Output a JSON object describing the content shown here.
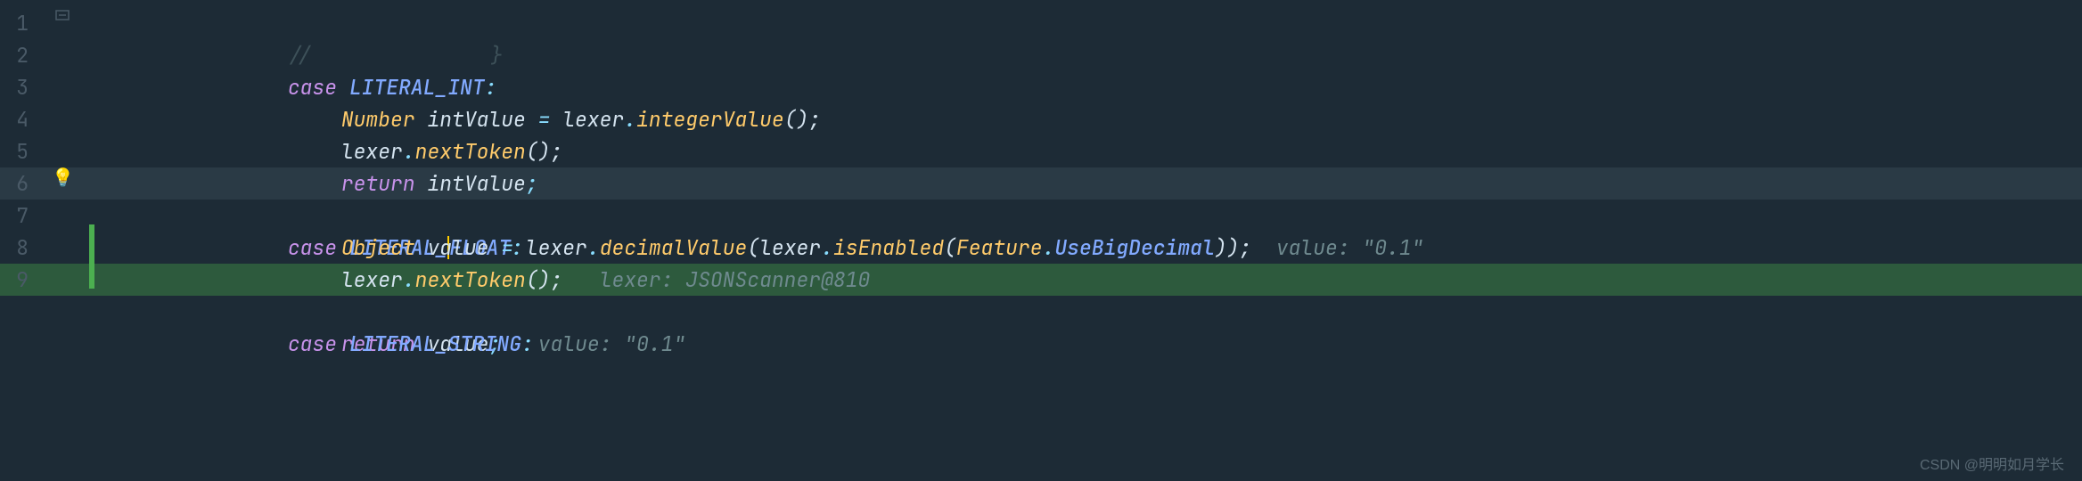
{
  "line_numbers": [
    "1",
    "2",
    "3",
    "4",
    "5",
    "6",
    "7",
    "8",
    "9"
  ],
  "code": {
    "l0": {
      "comment": "//",
      "brace": "}"
    },
    "l1": {
      "kw": "case",
      "const": "LITERAL_INT",
      "colon": ":"
    },
    "l2": {
      "type": "Number",
      "ident": "intValue",
      "eq": " = ",
      "obj": "lexer",
      "dot": ".",
      "method": "integerValue",
      "call": "();"
    },
    "l3": {
      "obj": "lexer",
      "dot": ".",
      "method": "nextToken",
      "call": "();"
    },
    "l4": {
      "kw": "return",
      "ident": "intValue",
      "semi": ";"
    },
    "l5": {
      "kw": "case",
      "const_a": "LITERAL_",
      "const_b": "FLOAT",
      "colon": ":"
    },
    "l6": {
      "type": "Object",
      "ident": "value",
      "eq": " = ",
      "obj": "lexer",
      "dot": ".",
      "method": "decimalValue",
      "open": "(",
      "obj2": "lexer",
      "dot2": ".",
      "method2": "isEnabled",
      "open2": "(",
      "cls": "Feature",
      "dot3": ".",
      "field": "UseBigDecimal",
      "close": "));",
      "hint_lbl": "  value: ",
      "hint_val": "\"0.1\""
    },
    "l7": {
      "obj": "lexer",
      "dot": ".",
      "method": "nextToken",
      "call": "();",
      "hint_lbl": "   lexer: ",
      "hint_val": "JSONScanner@810"
    },
    "l8": {
      "kw": "return",
      "ident": "value",
      "semi": ";",
      "hint_lbl": "   value: ",
      "hint_val": "\"0.1\""
    },
    "l9": {
      "kw": "case",
      "const": "LITERAL_STRING",
      "colon": ":"
    }
  },
  "watermark": "CSDN @明明如月学长"
}
